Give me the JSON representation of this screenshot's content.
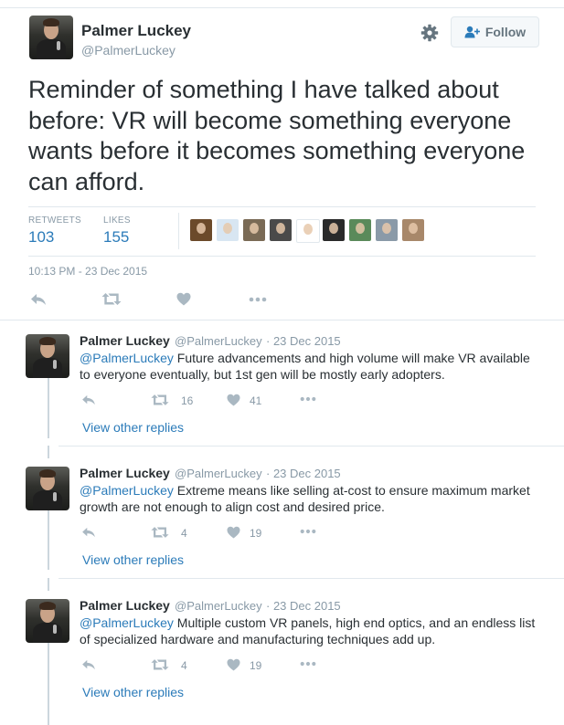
{
  "main_tweet": {
    "name": "Palmer Luckey",
    "handle": "@PalmerLuckey",
    "follow_label": "Follow",
    "text": "Reminder of something I have talked about before: VR will become something everyone wants before it becomes something everyone can afford.",
    "retweets_label": "RETWEETS",
    "retweets_count": "103",
    "likes_label": "LIKES",
    "likes_count": "155",
    "timestamp": "10:13 PM - 23 Dec 2015"
  },
  "liker_avatar_colors": [
    "#6b4a2a",
    "#d8e6f2",
    "#7a6a55",
    "#4a4a4a",
    "#ffffff",
    "#2a2a2a",
    "#5a8a5a",
    "#8a9aa8",
    "#a8886a"
  ],
  "replies": [
    {
      "name": "Palmer Luckey",
      "handle": "@PalmerLuckey",
      "date": "· 23 Dec 2015",
      "mention": "@PalmerLuckey",
      "line1": " Future advancements and high volume will make VR available",
      "line2": "to everyone eventually, but 1st gen will be mostly early adopters.",
      "retweets": "16",
      "likes": "41",
      "view_replies": "View other replies"
    },
    {
      "name": "Palmer Luckey",
      "handle": "@PalmerLuckey",
      "date": "· 23 Dec 2015",
      "mention": "@PalmerLuckey",
      "line1": " Extreme means like selling at-cost to ensure maximum market",
      "line2": "growth are not enough to align cost and desired price.",
      "retweets": "4",
      "likes": "19",
      "view_replies": "View other replies"
    },
    {
      "name": "Palmer Luckey",
      "handle": "@PalmerLuckey",
      "date": "· 23 Dec 2015",
      "mention": "@PalmerLuckey",
      "line1": " Multiple custom VR panels, high end optics, and an endless list",
      "line2": "of specialized hardware and manufacturing techniques add up.",
      "retweets": "4",
      "likes": "19",
      "view_replies": "View other replies"
    }
  ],
  "icons": {
    "gear": "gear-icon",
    "follow": "follow-user-icon",
    "reply": "reply-icon",
    "retweet": "retweet-icon",
    "like": "heart-icon",
    "more": "more-icon"
  },
  "colors": {
    "link": "#2b7bb9",
    "muted": "#8899a6",
    "icon": "#aab8c2",
    "divider": "#e1e8ed"
  }
}
